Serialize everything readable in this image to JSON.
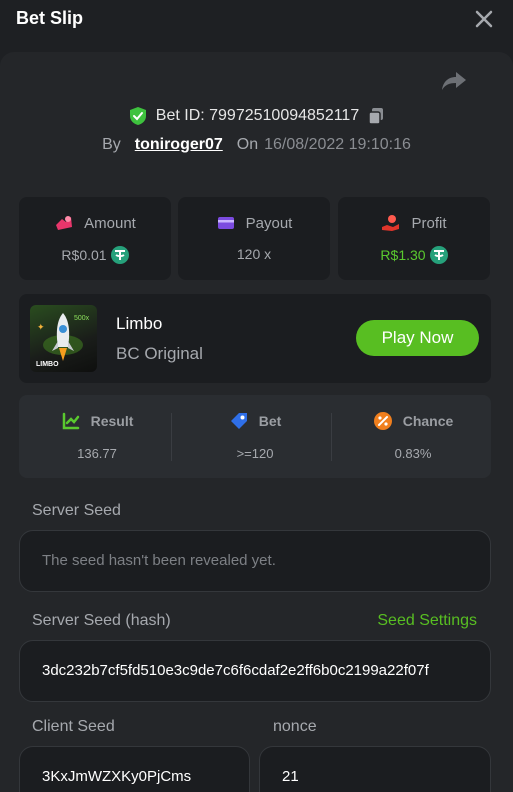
{
  "header": {
    "title": "Bet Slip"
  },
  "bet": {
    "id_label": "Bet ID: 79972510094852117",
    "by_label": "By",
    "username": "toniroger07",
    "on_label": "On",
    "date": "16/08/2022 19:10:16"
  },
  "stats": {
    "amount": {
      "label": "Amount",
      "value": "R$0.01"
    },
    "payout": {
      "label": "Payout",
      "value": "120 x"
    },
    "profit": {
      "label": "Profit",
      "value": "R$1.30"
    }
  },
  "game": {
    "name": "Limbo",
    "subtitle": "BC Original",
    "play_label": "Play Now",
    "thumb_label": "LIMBO",
    "thumb_multiplier": "500x"
  },
  "result": {
    "result": {
      "label": "Result",
      "value": "136.77"
    },
    "bet": {
      "label": "Bet",
      "value": ">=120"
    },
    "chance": {
      "label": "Chance",
      "value": "0.83%"
    }
  },
  "server_seed": {
    "label": "Server Seed",
    "placeholder": "The seed hasn't been revealed yet."
  },
  "server_seed_hash": {
    "label": "Server Seed (hash)",
    "settings_label": "Seed Settings",
    "value": "3dc232b7cf5fd510e3c9de7c6f6cdaf2e2ff6b0c2199a22f07f"
  },
  "client_seed": {
    "label": "Client Seed",
    "value": "3KxJmWZXKy0PjCms"
  },
  "nonce": {
    "label": "nonce",
    "value": "21"
  },
  "colors": {
    "accent_green": "#58be22",
    "background": "#1e2023",
    "card": "#1b1d20"
  },
  "icons": {
    "close": "close-icon",
    "share": "share-icon",
    "shield": "shield-check-icon",
    "copy": "copy-icon",
    "coin": "tether-coin-icon"
  }
}
